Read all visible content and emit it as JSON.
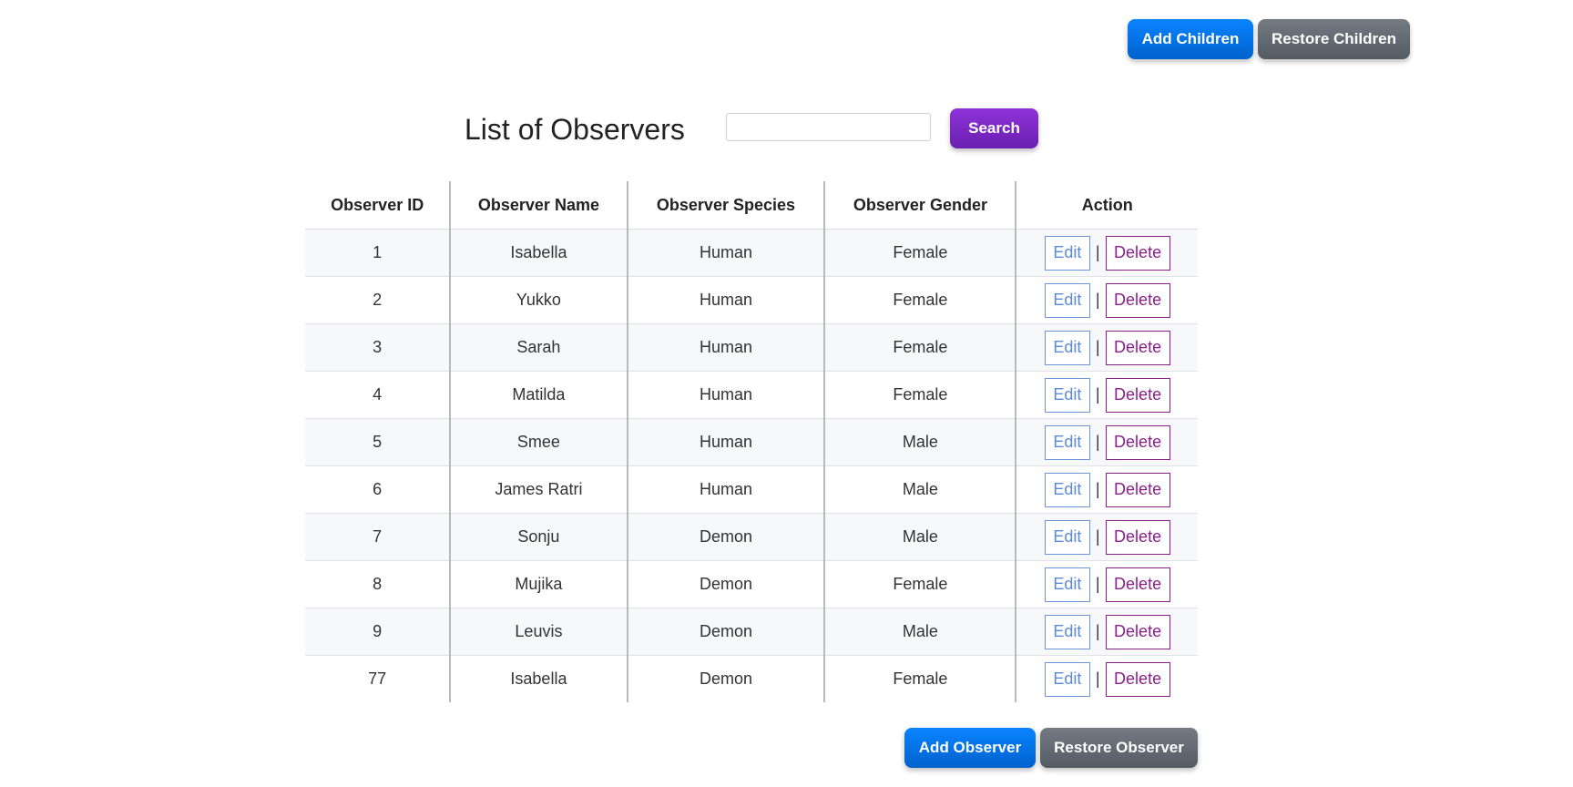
{
  "top_actions": {
    "add_children_label": "Add Children",
    "restore_children_label": "Restore Children"
  },
  "header": {
    "title": "List of Observers",
    "search_placeholder": "",
    "search_value": "",
    "search_label": "Search"
  },
  "table": {
    "columns": [
      "Observer ID",
      "Observer Name",
      "Observer Species",
      "Observer Gender",
      "Action"
    ],
    "edit_label": "Edit",
    "delete_label": "Delete",
    "separator": "|",
    "rows": [
      {
        "id": "1",
        "name": "Isabella",
        "species": "Human",
        "gender": "Female"
      },
      {
        "id": "2",
        "name": "Yukko",
        "species": "Human",
        "gender": "Female"
      },
      {
        "id": "3",
        "name": "Sarah",
        "species": "Human",
        "gender": "Female"
      },
      {
        "id": "4",
        "name": "Matilda",
        "species": "Human",
        "gender": "Female"
      },
      {
        "id": "5",
        "name": "Smee",
        "species": "Human",
        "gender": "Male"
      },
      {
        "id": "6",
        "name": "James Ratri",
        "species": "Human",
        "gender": "Male"
      },
      {
        "id": "7",
        "name": "Sonju",
        "species": "Demon",
        "gender": "Male"
      },
      {
        "id": "8",
        "name": "Mujika",
        "species": "Demon",
        "gender": "Female"
      },
      {
        "id": "9",
        "name": "Leuvis",
        "species": "Demon",
        "gender": "Male"
      },
      {
        "id": "77",
        "name": "Isabella",
        "species": "Demon",
        "gender": "Female"
      }
    ]
  },
  "bottom_actions": {
    "add_observer_label": "Add Observer",
    "restore_observer_label": "Restore Observer"
  },
  "colors": {
    "primary_blue": "#0a84ff",
    "secondary_gray": "#6c757d",
    "search_purple": "#7b2bc6",
    "edit_blue": "#5b8bd8",
    "delete_purple": "#8a1f8a"
  }
}
